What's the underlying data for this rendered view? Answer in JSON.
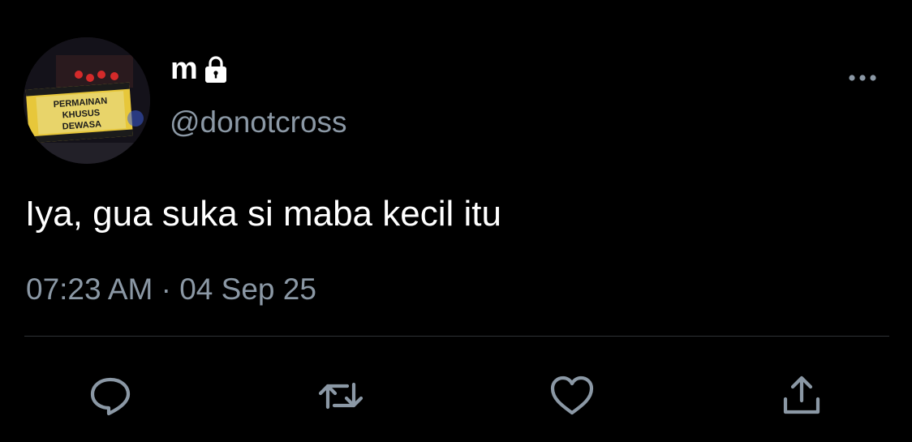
{
  "user": {
    "display_name": "m",
    "handle": "@donotcross",
    "avatar_sign_text": [
      "PERMAINAN",
      "KHUSUS",
      "DEWASA"
    ]
  },
  "tweet": {
    "text": "Iya, gua suka si maba kecil itu",
    "timestamp": "07:23 AM · 04 Sep 25"
  },
  "icons": {
    "lock": "lock-icon",
    "more": "more-horizontal-icon",
    "reply": "reply-icon",
    "retweet": "retweet-icon",
    "like": "like-icon",
    "share": "share-icon"
  },
  "colors": {
    "background": "#000000",
    "text_primary": "#ffffff",
    "text_secondary": "#8b98a5",
    "divider": "#2f3336"
  }
}
